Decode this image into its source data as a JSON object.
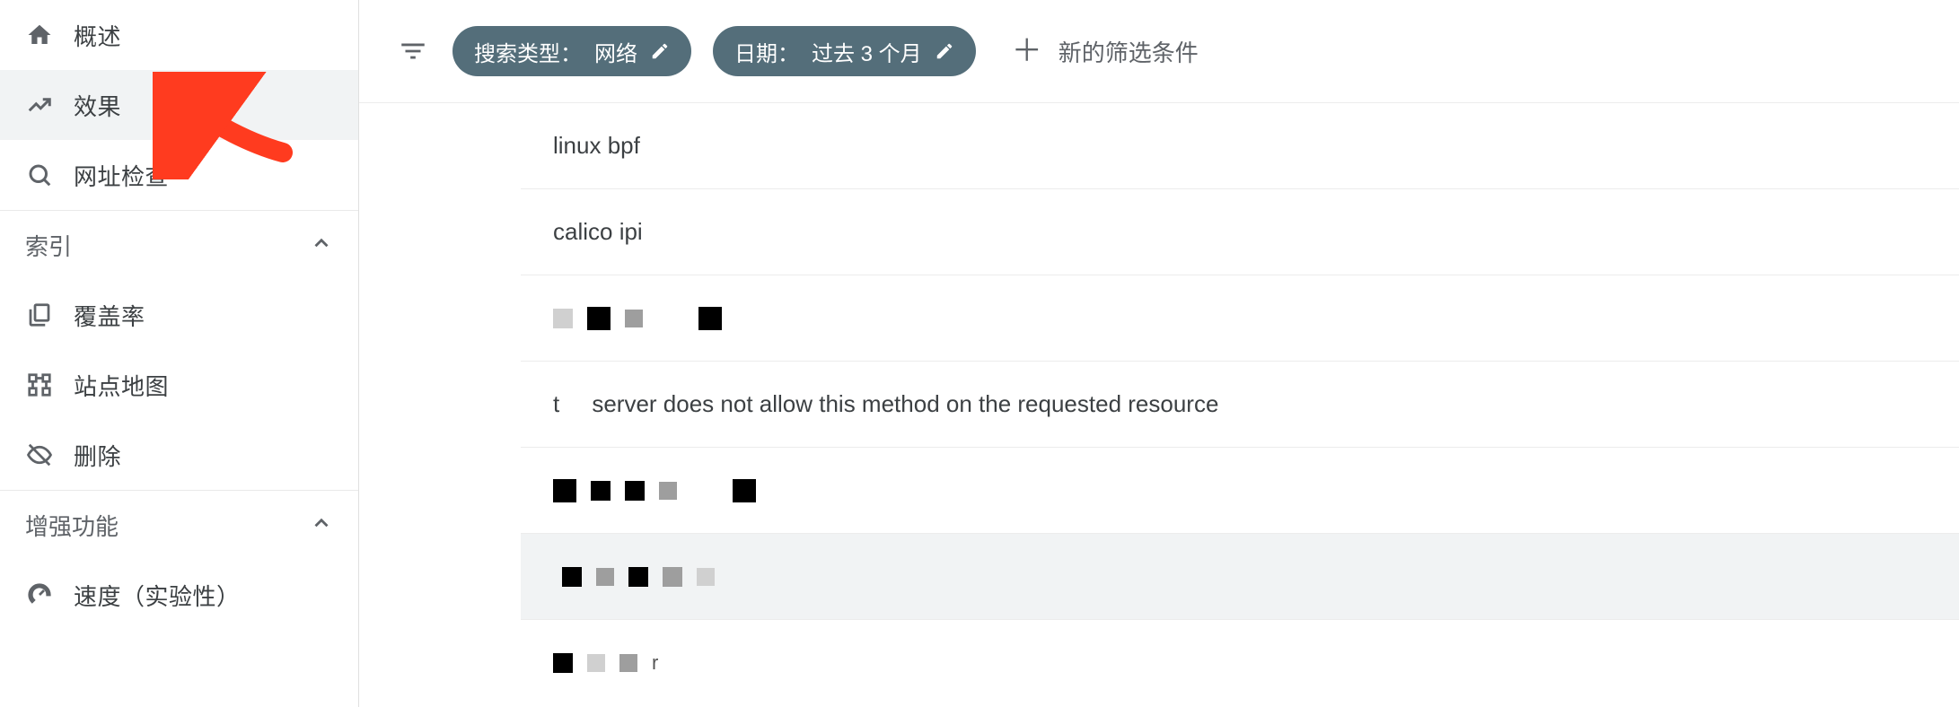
{
  "sidebar": {
    "top_items": [
      {
        "icon": "home-icon",
        "label": "概述"
      },
      {
        "icon": "trend-icon",
        "label": "效果"
      },
      {
        "icon": "search-icon",
        "label": "网址检查"
      }
    ],
    "index_section": {
      "title": "索引",
      "items": [
        {
          "icon": "copies-icon",
          "label": "覆盖率"
        },
        {
          "icon": "sitemap-icon",
          "label": "站点地图"
        },
        {
          "icon": "hide-icon",
          "label": "删除"
        }
      ]
    },
    "enhance_section": {
      "title": "增强功能",
      "items": [
        {
          "icon": "speed-icon",
          "label": "速度（实验性）"
        }
      ]
    }
  },
  "filters": {
    "search_type": {
      "prefix": "搜索类型：",
      "value": "网络"
    },
    "date": {
      "prefix": "日期：",
      "value": "过去 3 个月"
    },
    "add_label": "新的筛选条件"
  },
  "rows": [
    {
      "kind": "text",
      "text": "linux bpf"
    },
    {
      "kind": "text",
      "text": "calico ipi"
    },
    {
      "kind": "redacted"
    },
    {
      "kind": "text",
      "text": "t     server does not allow this method on the requested resource"
    },
    {
      "kind": "redacted"
    },
    {
      "kind": "redacted",
      "hover": true
    },
    {
      "kind": "redacted"
    }
  ],
  "colors": {
    "chip_bg": "#546e7a",
    "sidebar_selected_bg": "#f1f3f4",
    "icon_grey": "#5f6368",
    "arrow": "#ff3b1f"
  }
}
